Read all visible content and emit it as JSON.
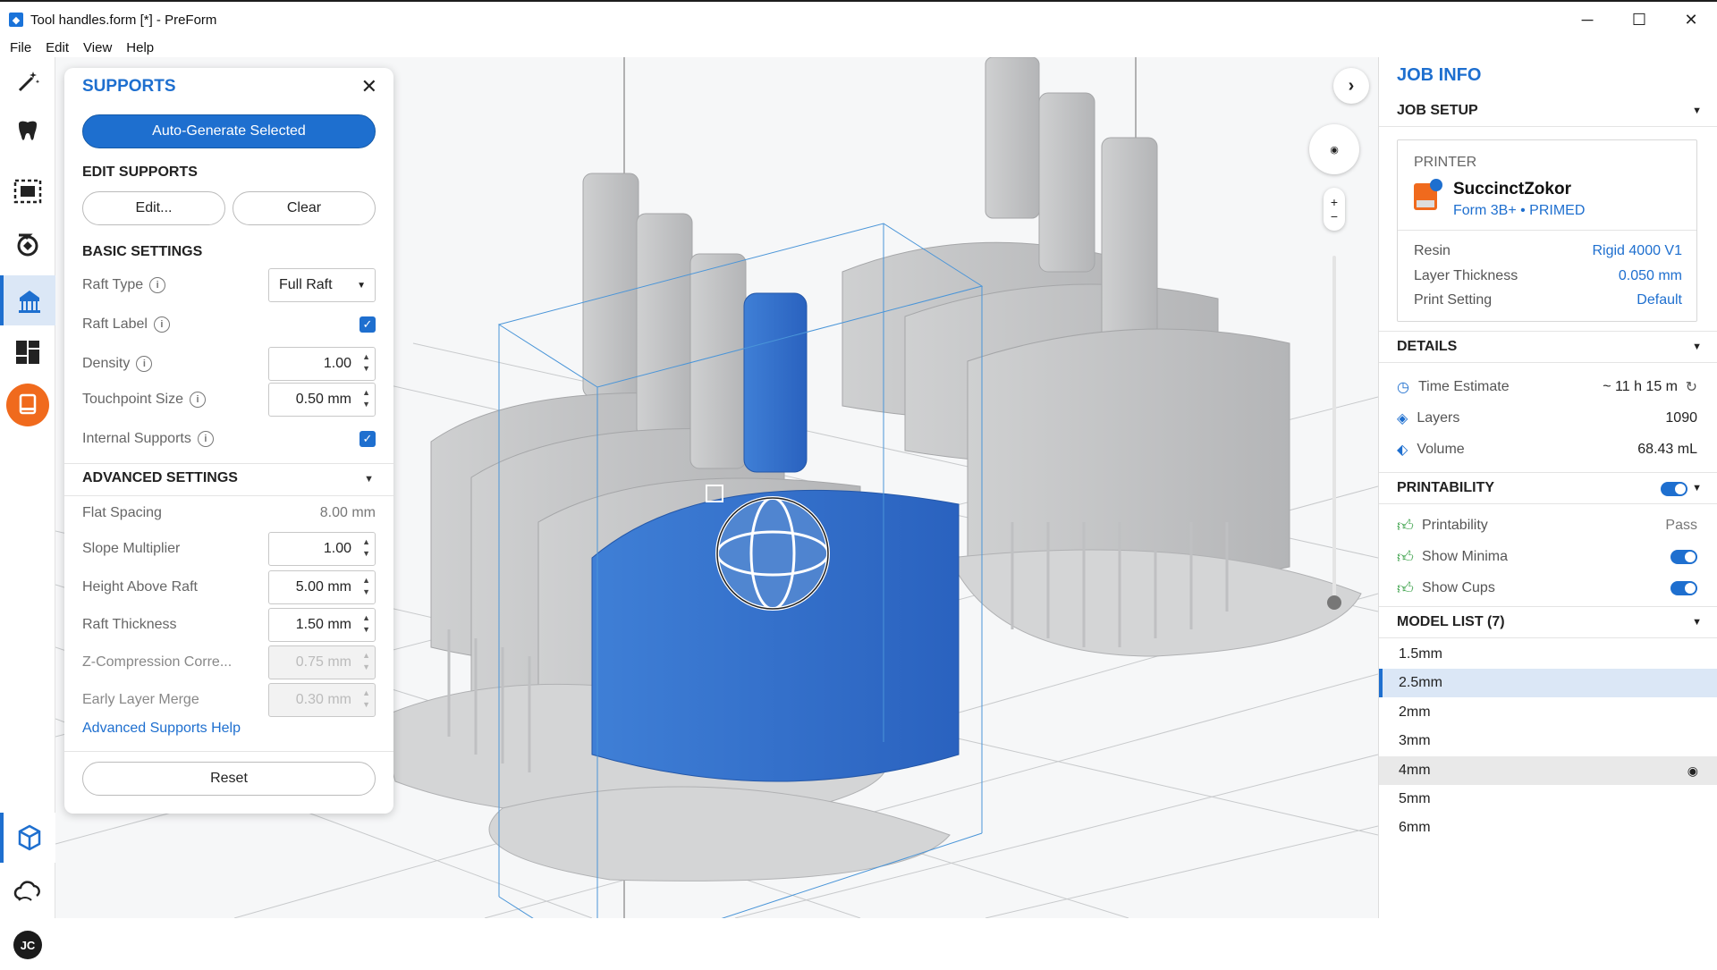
{
  "window": {
    "title": "Tool handles.form [*] - PreForm",
    "minimize": "─",
    "maximize": "☐",
    "close": "✕"
  },
  "menu": [
    "File",
    "Edit",
    "View",
    "Help"
  ],
  "toolbar": {
    "user_initials": "JC"
  },
  "supports": {
    "title": "SUPPORTS",
    "close": "✕",
    "auto_generate": "Auto-Generate Selected",
    "edit_header": "EDIT SUPPORTS",
    "edit_btn": "Edit...",
    "clear_btn": "Clear",
    "basic_header": "BASIC SETTINGS",
    "raft_type_label": "Raft Type",
    "raft_type_value": "Full Raft",
    "raft_label_label": "Raft Label",
    "raft_label_checked": true,
    "density_label": "Density",
    "density_value": "1.00",
    "touchpoint_label": "Touchpoint Size",
    "touchpoint_value": "0.50 mm",
    "internal_label": "Internal Supports",
    "internal_checked": true,
    "advanced_header": "ADVANCED SETTINGS",
    "flat_spacing_label": "Flat Spacing",
    "flat_spacing_value": "8.00 mm",
    "slope_label": "Slope Multiplier",
    "slope_value": "1.00",
    "height_label": "Height Above Raft",
    "height_value": "5.00 mm",
    "raft_thickness_label": "Raft Thickness",
    "raft_thickness_value": "1.50 mm",
    "zcomp_label": "Z-Compression Corre...",
    "zcomp_value": "0.75 mm",
    "early_label": "Early Layer Merge",
    "early_value": "0.30 mm",
    "help_link": "Advanced Supports Help",
    "reset": "Reset"
  },
  "job": {
    "title": "JOB INFO",
    "setup_header": "JOB SETUP",
    "printer_label": "PRINTER",
    "printer_name": "SuccinctZokor",
    "printer_model": "Form 3B+ • PRIMED",
    "resin_label": "Resin",
    "resin_value": "Rigid 4000 V1",
    "layer_label": "Layer Thickness",
    "layer_value": "0.050 mm",
    "setting_label": "Print Setting",
    "setting_value": "Default",
    "details_header": "DETAILS",
    "time_label": "Time Estimate",
    "time_value": "~ 11 h 15 m",
    "layers_label": "Layers",
    "layers_value": "1090",
    "volume_label": "Volume",
    "volume_value": "68.43 mL",
    "printability_header": "PRINTABILITY",
    "printability_label": "Printability",
    "printability_value": "Pass",
    "minima_label": "Show Minima",
    "cups_label": "Show Cups",
    "model_list_header": "MODEL LIST (7)",
    "models": [
      "1.5mm",
      "2.5mm",
      "2mm",
      "3mm",
      "4mm",
      "5mm",
      "6mm"
    ]
  },
  "colors": {
    "accent": "#1e6fcf",
    "selected_model": "#2f6fcf",
    "model_grey": "#c9cacb",
    "pass_green": "#2c9a3b"
  }
}
